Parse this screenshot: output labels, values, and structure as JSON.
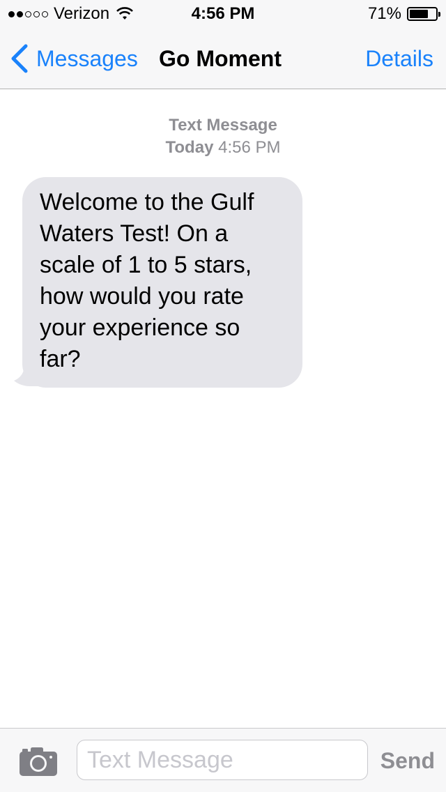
{
  "status_bar": {
    "signal_strength": "2 of 5",
    "carrier": "Verizon",
    "wifi_icon": "wifi-icon",
    "time": "4:56 PM",
    "battery_percent": "71%",
    "battery_level": 0.71
  },
  "nav": {
    "back_label": "Messages",
    "back_icon": "chevron-left-icon",
    "title": "Go Moment",
    "details_label": "Details",
    "accent_color": "#1a82fb"
  },
  "thread": {
    "service": "Text Message",
    "day": "Today",
    "time": "4:56 PM",
    "messages": [
      {
        "direction": "incoming",
        "text": "Welcome to the Gulf Waters Test! On a scale of 1 to 5 stars, how would you rate your experience so far?",
        "bubble_color": "#e5e5ea"
      }
    ]
  },
  "composer": {
    "camera_icon": "camera-icon",
    "placeholder": "Text Message",
    "value": "",
    "send_label": "Send"
  }
}
